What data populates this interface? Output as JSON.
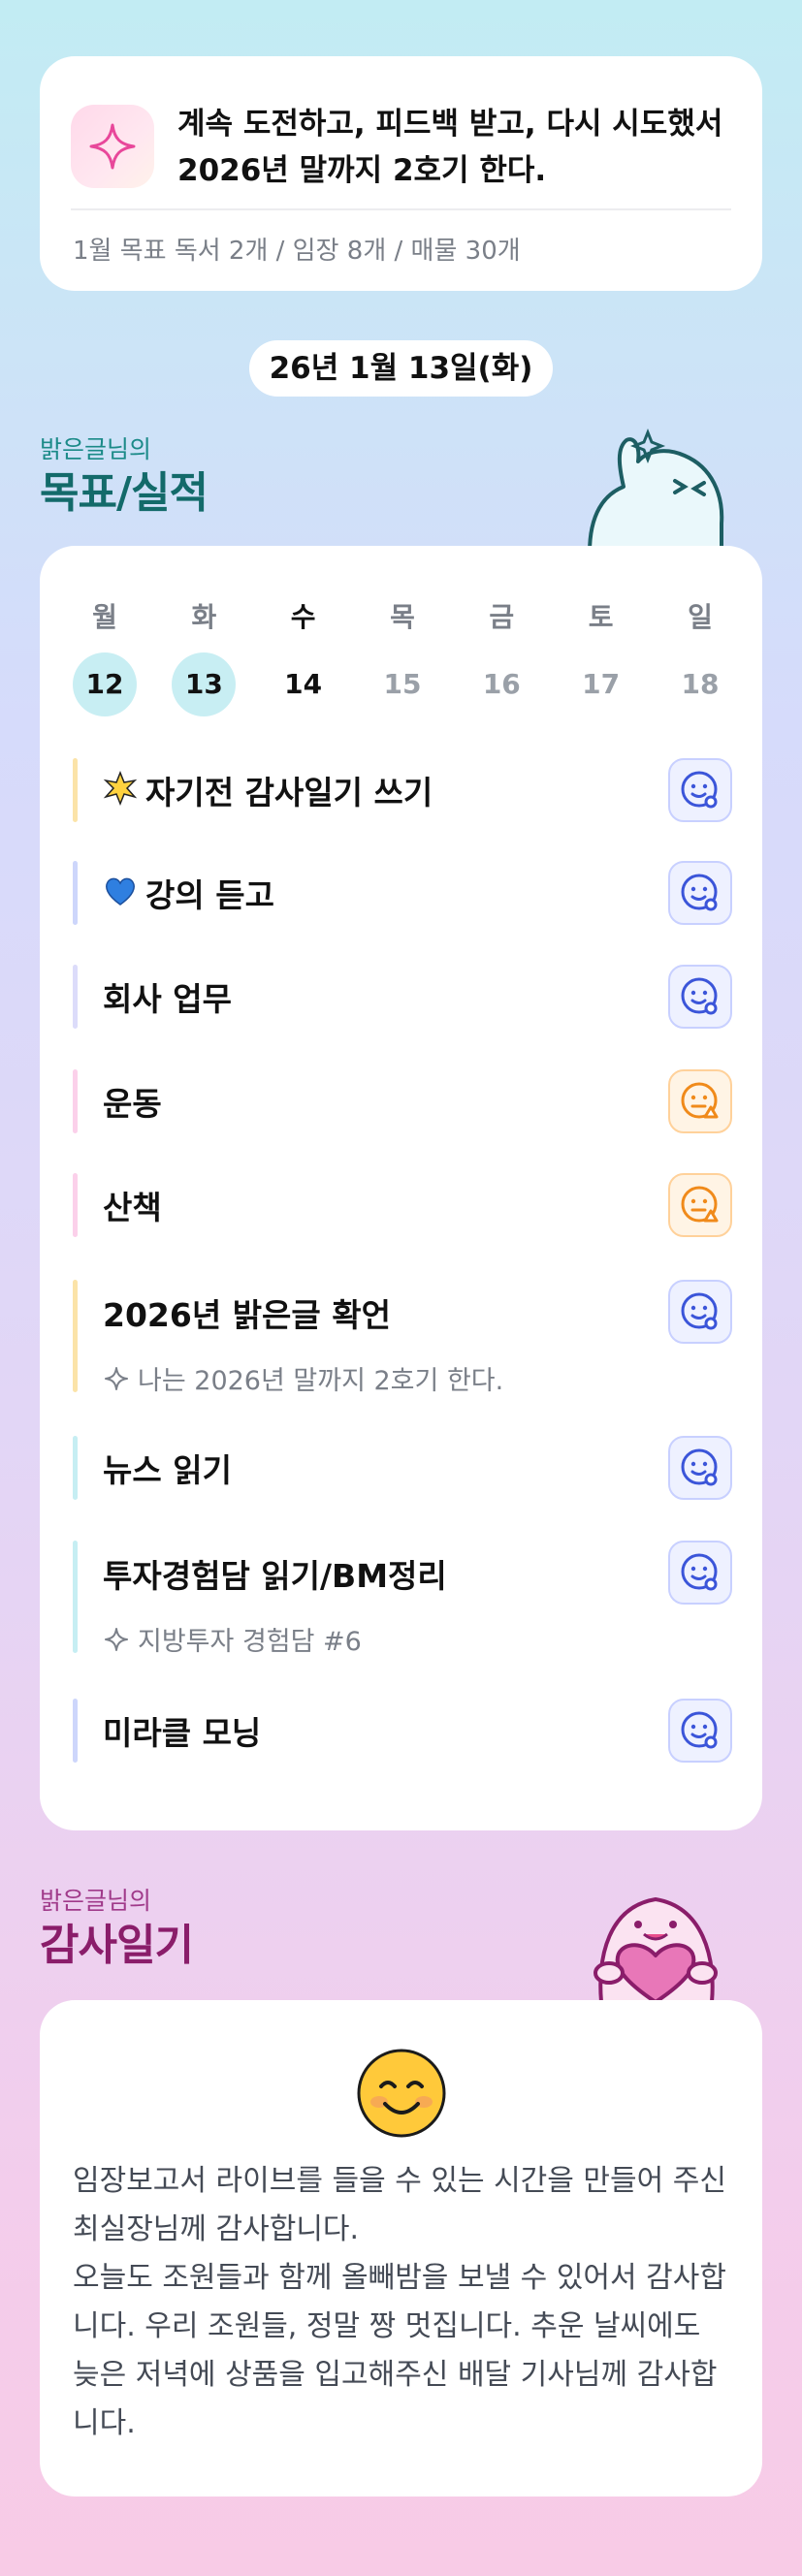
{
  "goal": {
    "text": "계속 도전하고, 피드백 받고, 다시 시도했서 2026년 말까지 2호기 한다.",
    "monthly": "1월 목표  독서 2개 / 임장 8개 / 매물 30개"
  },
  "date_label": "26년 1월 13일(화)",
  "goals_section": {
    "subtitle": "밝은글님의",
    "title": "목표/실적"
  },
  "week": {
    "days": [
      "월",
      "화",
      "수",
      "목",
      "금",
      "토",
      "일"
    ],
    "dates": [
      "12",
      "13",
      "14",
      "15",
      "16",
      "17",
      "18"
    ]
  },
  "tasks": [
    {
      "label": "자기전 감사일기 쓰기",
      "icon": "sparkle-emoji",
      "bar_color": "#fbe3a8",
      "status": "ok"
    },
    {
      "label": "강의 듣고",
      "icon": "blue-heart-emoji",
      "bar_color": "#cdd6fb",
      "status": "ok"
    },
    {
      "label": "회사 업무",
      "bar_color": "#dcdcfa",
      "status": "ok"
    },
    {
      "label": "운동",
      "bar_color": "#fbd0ea",
      "status": "warn"
    },
    {
      "label": "산책",
      "bar_color": "#fbd0ea",
      "status": "warn"
    },
    {
      "label": "2026년 밝은글 확언",
      "bar_color": "#fbe3a8",
      "status": "ok",
      "note": "나는 2026년 말까지 2호기 한다."
    },
    {
      "label": "뉴스 읽기",
      "bar_color": "#c6eef3",
      "status": "ok"
    },
    {
      "label": "투자경험담 읽기/BM정리",
      "bar_color": "#c6eef3",
      "status": "ok",
      "note": "지방투자 경험담 #6"
    },
    {
      "label": "미라클 모닝",
      "bar_color": "#cdd6fb",
      "status": "ok"
    }
  ],
  "gratitude_section": {
    "subtitle": "밝은글님의",
    "title": "감사일기"
  },
  "gratitude": {
    "text": "임장보고서 라이브를 들을 수 있는 시간을 만들어 주신 최실장님께 감사합니다.\n오늘도 조원들과 함께 올빼밤을 보낼 수 있어서 감사합니다. 우리 조원들, 정말 짱 멋집니다. 추운 날씨에도 늦은 저녁에 상품을 입고해주신 배달 기사님께 감사합니다."
  },
  "colors": {
    "accent_teal": "#136a6a",
    "accent_magenta": "#8a1d6a",
    "status_ok": "#3b55d9",
    "status_warn": "#f08a1a"
  }
}
